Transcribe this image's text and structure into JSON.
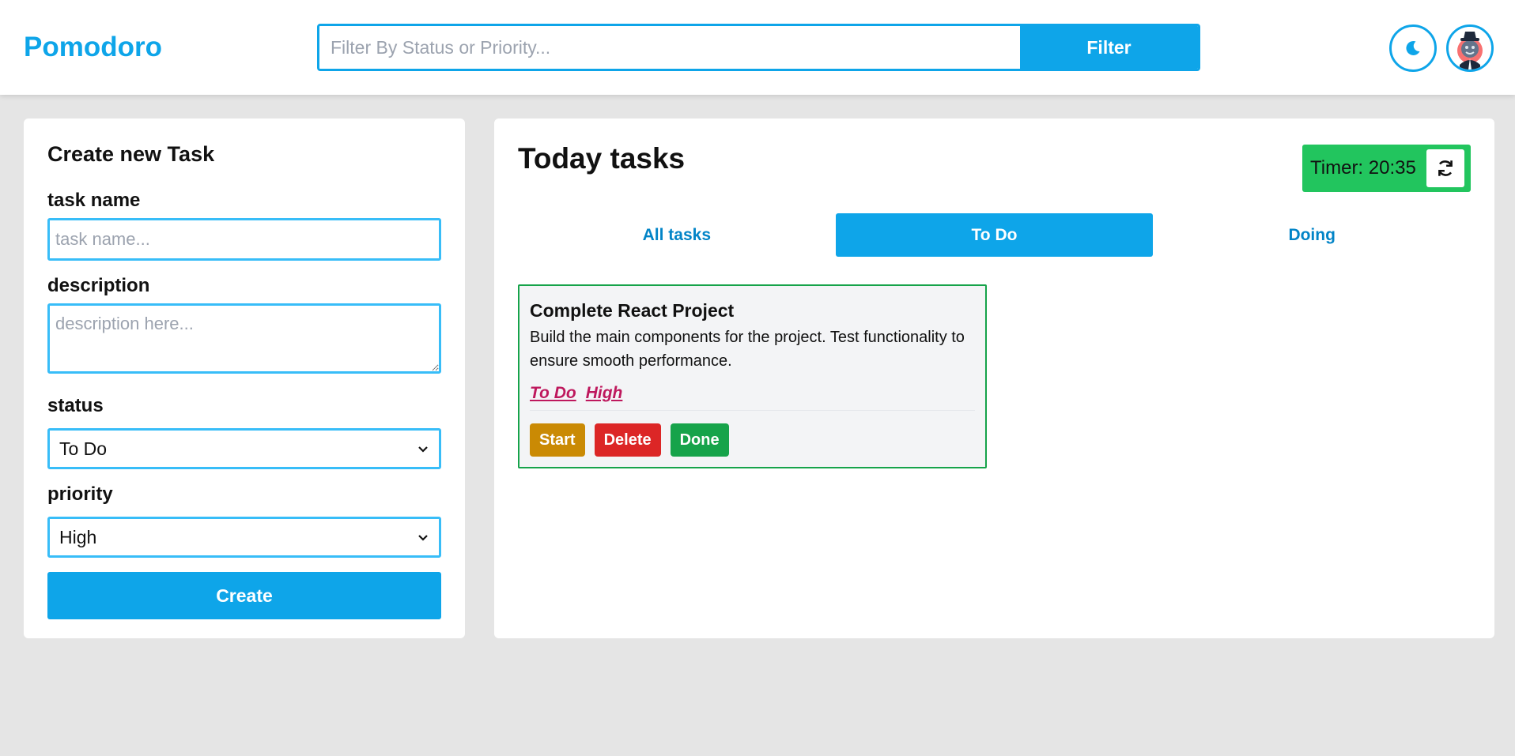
{
  "header": {
    "logo": "Pomodoro",
    "filter_placeholder": "Filter By Status or Priority...",
    "filter_button": "Filter",
    "theme_icon": "moon-icon",
    "avatar_icon": "user-avatar-icon"
  },
  "create_form": {
    "title": "Create new Task",
    "task_name_label": "task name",
    "task_name_placeholder": "task name...",
    "description_label": "description",
    "description_placeholder": "description here...",
    "status_label": "status",
    "status_value": "To Do",
    "priority_label": "priority",
    "priority_value": "High",
    "create_button": "Create"
  },
  "tasks_panel": {
    "title": "Today tasks",
    "timer_text": "Timer: 20:35",
    "refresh_icon": "refresh-icon",
    "tabs": [
      {
        "label": "All tasks",
        "active": false
      },
      {
        "label": "To Do",
        "active": true
      },
      {
        "label": "Doing",
        "active": false
      }
    ],
    "cards": [
      {
        "title": "Complete React Project",
        "description": "Build the main components for the project. Test functionality to ensure smooth performance.",
        "status_tag": "To Do",
        "priority_tag": "High",
        "start_label": "Start",
        "delete_label": "Delete",
        "done_label": "Done"
      }
    ]
  },
  "colors": {
    "accent": "#0ea5e9",
    "timer_bg": "#22c55e",
    "start": "#ca8a04",
    "delete": "#dc2626",
    "done": "#16a34a",
    "tag": "#be185d"
  }
}
